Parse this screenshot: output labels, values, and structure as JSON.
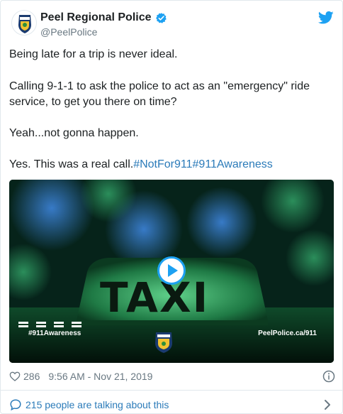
{
  "author": {
    "name": "Peel Regional Police",
    "handle": "@PeelPolice",
    "avatar_icon": "police-badge-icon",
    "verified_icon": "verified-badge-icon"
  },
  "tweet": {
    "line1": "Being late for a trip is never ideal.",
    "line2": "Calling 9-1-1 to ask the police to act as an \"emergency\" ride service, to get you there on time?",
    "line3": "Yeah...not gonna happen.",
    "line4_text": "Yes. This was a real call.",
    "hashtag1": "#NotFor911",
    "hashtag2": "#911Awareness"
  },
  "video": {
    "sign_text": "TAXI",
    "left_caption": "#911Awareness",
    "right_caption": "PeelPolice.ca/911",
    "play_icon": "play-icon"
  },
  "footer": {
    "likes": "286",
    "timestamp": "9:56 AM - Nov 21, 2019",
    "talking": "215 people are talking about this"
  },
  "colors": {
    "link": "#2b7bb9",
    "twitter_blue": "#1da1f2",
    "muted": "#697882",
    "border": "#e1e8ed"
  }
}
